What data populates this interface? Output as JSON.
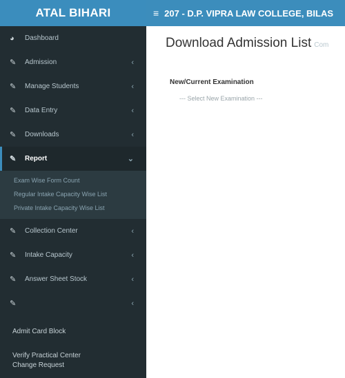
{
  "brand": {
    "title": "ATAL BIHARI"
  },
  "header": {
    "menu_icon": "hamburger-icon",
    "college_name": "207 - D.P. VIPRA LAW COLLEGE, BILAS"
  },
  "sidebar": {
    "items": [
      {
        "label": "Dashboard",
        "icon": "dashboard-icon"
      },
      {
        "label": "Admission",
        "icon": "edit-icon"
      },
      {
        "label": "Manage Students",
        "icon": "edit-icon"
      },
      {
        "label": "Data Entry",
        "icon": "edit-icon"
      },
      {
        "label": "Downloads",
        "icon": "edit-icon"
      },
      {
        "label": "Report",
        "icon": "edit-icon"
      },
      {
        "label": "Collection Center",
        "icon": "edit-icon"
      },
      {
        "label": "Intake Capacity",
        "icon": "edit-icon"
      },
      {
        "label": "Answer Sheet Stock",
        "icon": "edit-icon"
      },
      {
        "label": "",
        "icon": "edit-icon"
      }
    ],
    "report_submenu": [
      "Exam Wise Form Count",
      "Regular Intake Capacity Wise List",
      "Private Intake Capacity Wise List"
    ],
    "admit_card_block": "Admit Card Block",
    "verify_practical_line1": "Verify Practical Center",
    "verify_practical_line2": "Change Request"
  },
  "main": {
    "title": "Download Admission List",
    "subtitle": "Com",
    "exam_label": "New/Current Examination",
    "exam_select_value": "--- Select New Examination ---"
  },
  "colors": {
    "brand_bg": "#3b8dbd",
    "header_bg": "#3c8dbc",
    "sidebar_bg": "#222d32",
    "submenu_bg": "#2c3b41"
  }
}
